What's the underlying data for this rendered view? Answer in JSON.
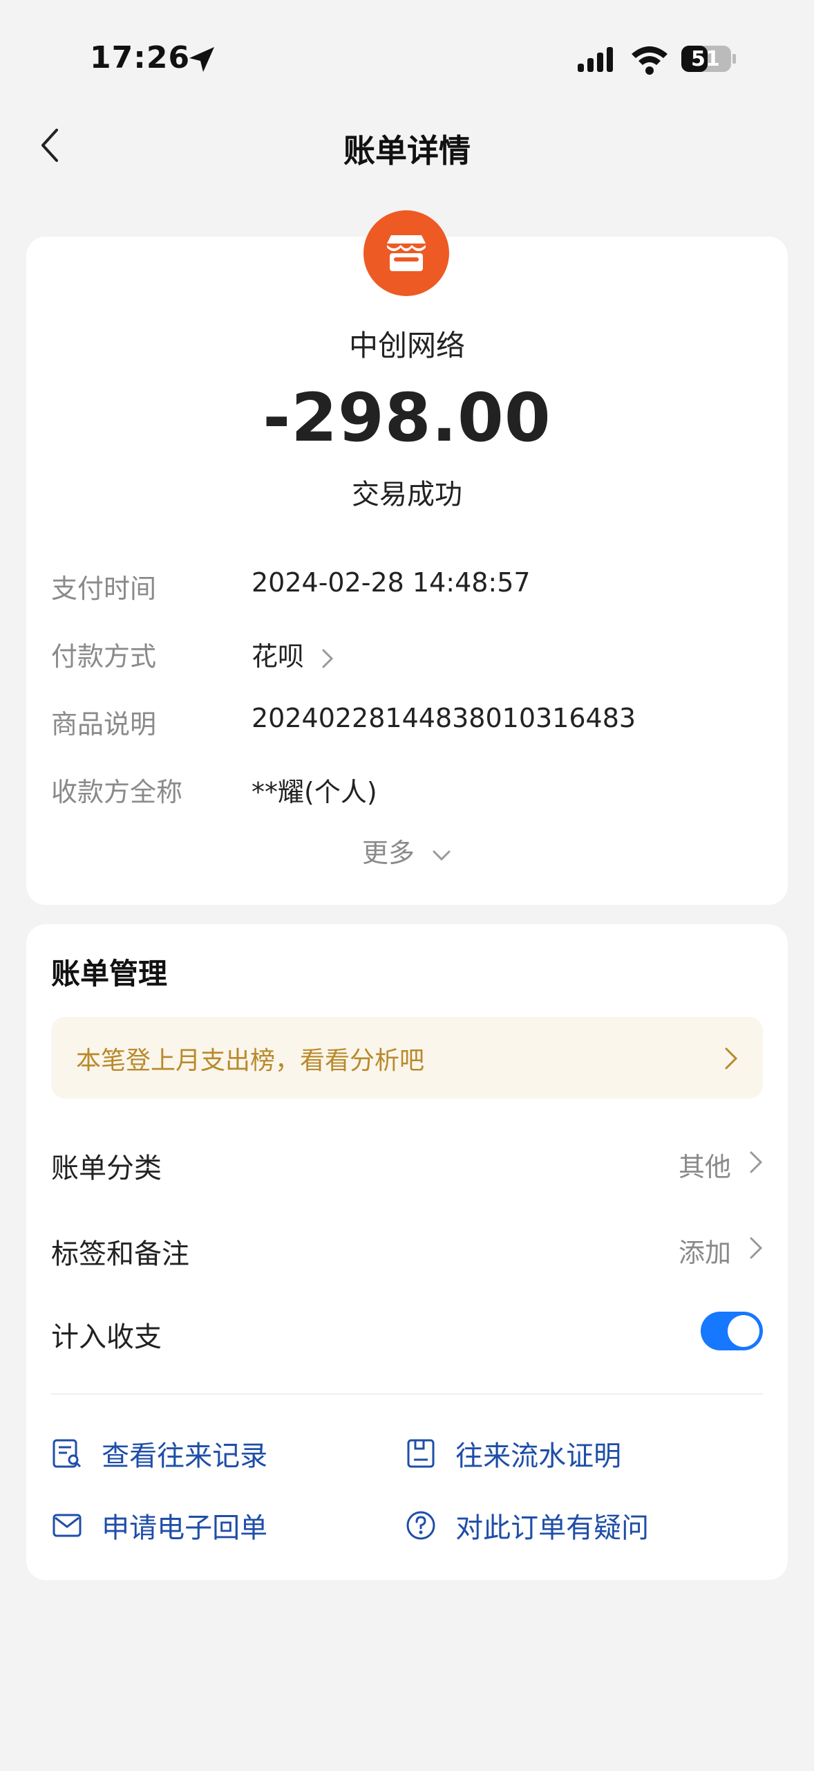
{
  "status_bar": {
    "time": "17:26",
    "battery": "51",
    "icons": [
      "location-arrow-icon",
      "signal-icon",
      "wifi-icon",
      "battery-icon"
    ]
  },
  "nav": {
    "title": "账单详情",
    "back_icon": "chevron-left-icon"
  },
  "summary": {
    "merchant": "中创网络",
    "amount": "-298.00",
    "status": "交易成功",
    "logo_icon": "shop-icon",
    "logo_color": "#ee5a24"
  },
  "details": [
    {
      "label": "支付时间",
      "value": "2024-02-28 14:48:57"
    },
    {
      "label": "付款方式",
      "value": "花呗"
    },
    {
      "label": "商品说明",
      "value": "2024022814483801031648​3"
    },
    {
      "label": "收款方全称",
      "value": "**耀(个人)"
    }
  ],
  "more_label": "更多",
  "management": {
    "title": "账单管理",
    "banner_text": "本笔登上月支出榜，看看分析吧",
    "banner_color": "#b88a2c",
    "rows": [
      {
        "label": "账单分类",
        "value": "其他"
      },
      {
        "label": "标签和备注",
        "value": "添加"
      },
      {
        "label": "计入收支",
        "toggle_on": true
      }
    ],
    "accent_color": "#1677ff",
    "links": [
      {
        "label": "查看往来记录",
        "icon": "record-search-icon"
      },
      {
        "label": "往来流水证明",
        "icon": "document-proof-icon"
      },
      {
        "label": "申请电子回单",
        "icon": "mail-icon"
      },
      {
        "label": "对此订单有疑问",
        "icon": "question-icon"
      }
    ]
  }
}
